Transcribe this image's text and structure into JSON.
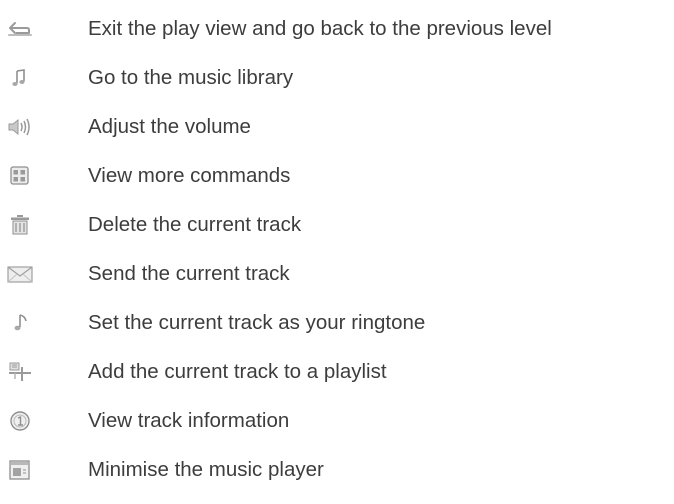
{
  "legend": {
    "items": [
      {
        "icon": "back-arrow-icon",
        "label": "Exit the play view and go back to the previous level"
      },
      {
        "icon": "music-note-icon",
        "label": "Go to the music library"
      },
      {
        "icon": "volume-icon",
        "label": "Adjust the volume"
      },
      {
        "icon": "more-commands-icon",
        "label": "View more commands"
      },
      {
        "icon": "trash-icon",
        "label": "Delete the current track"
      },
      {
        "icon": "envelope-icon",
        "label": "Send the current track"
      },
      {
        "icon": "ringtone-icon",
        "label": "Set the current track as your ringtone"
      },
      {
        "icon": "add-to-playlist-icon",
        "label": "Add the current track to a playlist"
      },
      {
        "icon": "info-icon",
        "label": "View track information"
      },
      {
        "icon": "minimise-icon",
        "label": "Minimise the music player"
      }
    ]
  },
  "colors": {
    "text": "#3d3d3d",
    "icon_stroke": "#8a8a8a",
    "icon_fill": "#d6d6d6"
  }
}
